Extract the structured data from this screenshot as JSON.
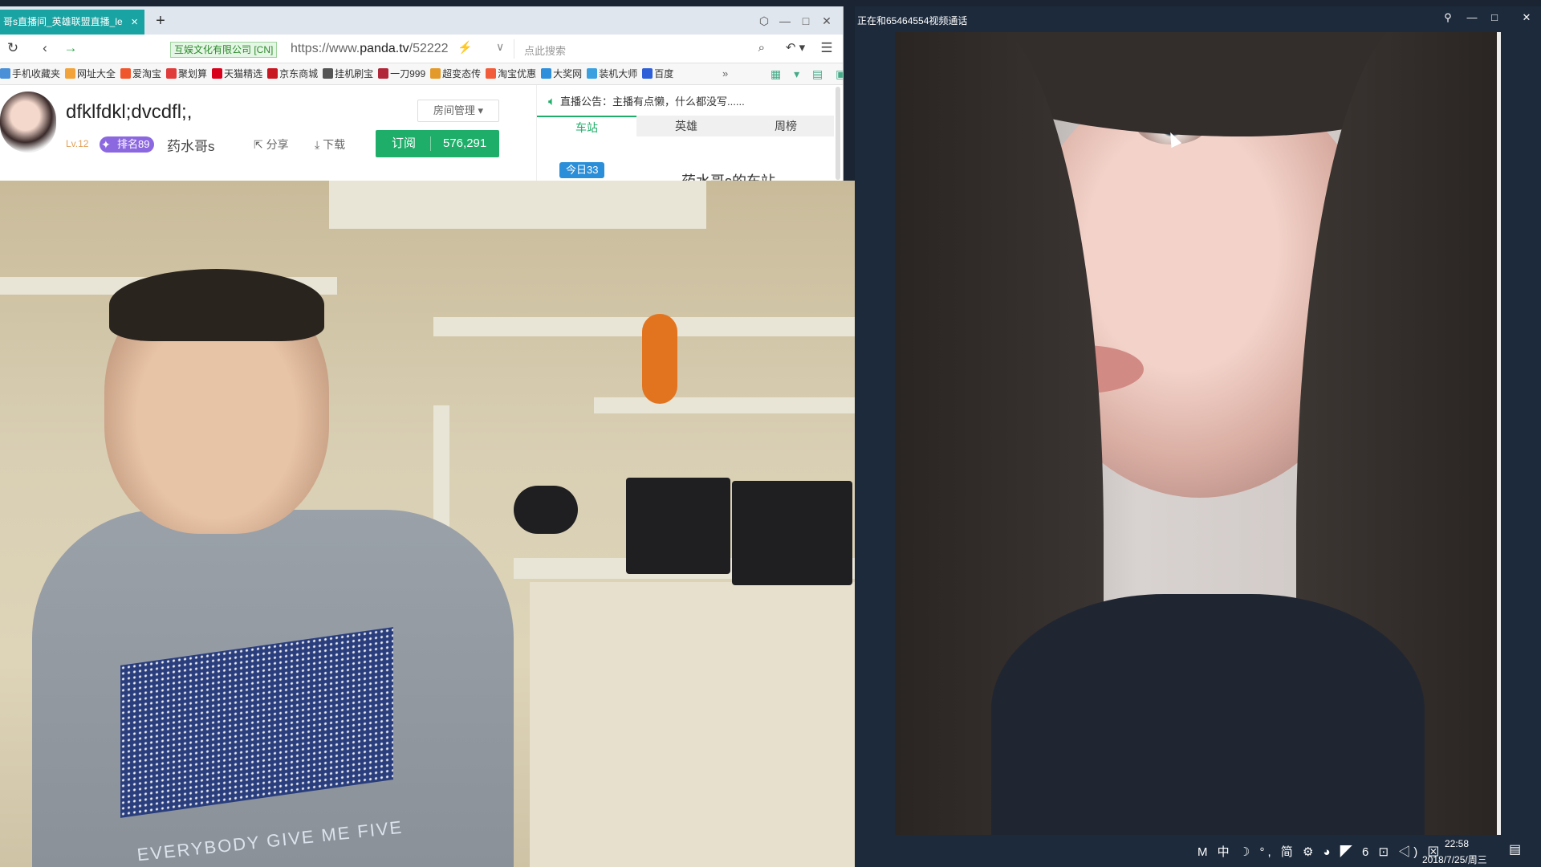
{
  "browser": {
    "tab_title": "哥s直播间_英雄联盟直播_le",
    "tab_close": "×",
    "new_tab": "+",
    "window_controls": [
      "⬡",
      "—",
      "□",
      "✕"
    ],
    "nav_icons": [
      "↻",
      "‹",
      "→"
    ],
    "cert_label": "互娱文化有限公司 [CN]",
    "url_prefix": "https://www.",
    "url_host": "panda.tv",
    "url_path": "/52222",
    "url_icon": "⚡",
    "url_chevron": "∨",
    "search_placeholder": "点此搜索",
    "search_icon": "⌕",
    "toolbar_icons": [
      "↶ ▾",
      "☰"
    ],
    "bookmarks": [
      {
        "label": "手机收藏夹",
        "color": "#4a90d9"
      },
      {
        "label": "网址大全",
        "color": "#f2a33a"
      },
      {
        "label": "爱淘宝",
        "color": "#f0562d"
      },
      {
        "label": "聚划算",
        "color": "#e03c3c"
      },
      {
        "label": "天猫精选",
        "color": "#d9001b"
      },
      {
        "label": "京东商城",
        "color": "#c81623"
      },
      {
        "label": "挂机刷宝",
        "color": "#555555"
      },
      {
        "label": "一刀999",
        "color": "#b2263a"
      },
      {
        "label": "超变态传",
        "color": "#e39a2a"
      },
      {
        "label": "淘宝优惠",
        "color": "#f25c3a"
      },
      {
        "label": "大奖网",
        "color": "#2e8fdc"
      },
      {
        "label": "装机大师",
        "color": "#3aa0e0"
      },
      {
        "label": "百度",
        "color": "#2e5fd8"
      }
    ],
    "bookmarks_more": "»",
    "bookmark_tools": "▦ ▾ ▤ ▣"
  },
  "room": {
    "anchor_name": "dfklfdkl;dvcdfl;,",
    "room_mgmt": "房间管理",
    "level": "Lv.12",
    "rank": "排名89",
    "fan_label": "药水哥s",
    "share": "分享",
    "download": "下载",
    "subscribe_label": "订阅",
    "subscribe_count": "576,291"
  },
  "panel": {
    "announcement": "直播公告：主播有点懒，什么都没写......",
    "tabs": [
      "车站",
      "英雄",
      "周榜"
    ],
    "active_tab": 0,
    "today_badge": "今日33",
    "station_title": "药水哥s的车站"
  },
  "stream": {
    "shirt_text": "EVERYBODY GIVE ME FIVE"
  },
  "vcall": {
    "title": "正在和65464554视频通话",
    "controls": [
      "⚲",
      "—",
      "□",
      "✕"
    ]
  },
  "tray": {
    "icons": "M 中 ☽ °, 简 ⚙ ◕ ◤ 6 ⊡ ◁) ⊠",
    "time": "22:58",
    "date": "2018/7/25/周三",
    "notification_icon": "▤"
  },
  "colors": {
    "accent_green": "#1fae69",
    "tab_teal": "#1aa3a3",
    "rank_purple": "#8c68e0",
    "today_blue": "#2a8fd8",
    "vcall_bg": "#1c2a3c"
  }
}
